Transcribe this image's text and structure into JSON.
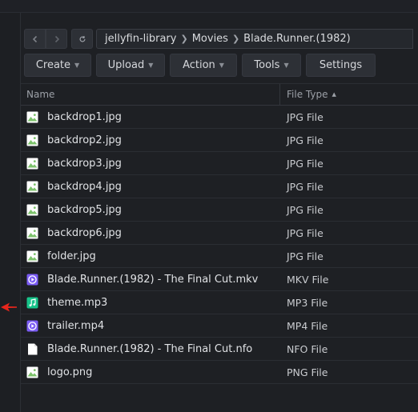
{
  "toolbar": {
    "back_icon": "chevron-left-icon",
    "forward_icon": "chevron-right-icon",
    "refresh_icon": "refresh-icon"
  },
  "breadcrumb": [
    "jellyfin-library",
    "Movies",
    "Blade.Runner.(1982)"
  ],
  "actions": [
    {
      "label": "Create",
      "dropdown": true
    },
    {
      "label": "Upload",
      "dropdown": true
    },
    {
      "label": "Action",
      "dropdown": true
    },
    {
      "label": "Tools",
      "dropdown": true
    },
    {
      "label": "Settings",
      "dropdown": false
    }
  ],
  "table": {
    "col_name": "Name",
    "col_type": "File Type",
    "rows": [
      {
        "name": "backdrop1.jpg",
        "type": "JPG File",
        "icon": "image-icon"
      },
      {
        "name": "backdrop2.jpg",
        "type": "JPG File",
        "icon": "image-icon"
      },
      {
        "name": "backdrop3.jpg",
        "type": "JPG File",
        "icon": "image-icon"
      },
      {
        "name": "backdrop4.jpg",
        "type": "JPG File",
        "icon": "image-icon"
      },
      {
        "name": "backdrop5.jpg",
        "type": "JPG File",
        "icon": "image-icon"
      },
      {
        "name": "backdrop6.jpg",
        "type": "JPG File",
        "icon": "image-icon"
      },
      {
        "name": "folder.jpg",
        "type": "JPG File",
        "icon": "image-icon"
      },
      {
        "name": "Blade.Runner.(1982) - The Final Cut.mkv",
        "type": "MKV File",
        "icon": "video-icon"
      },
      {
        "name": "theme.mp3",
        "type": "MP3 File",
        "icon": "audio-icon"
      },
      {
        "name": "trailer.mp4",
        "type": "MP4 File",
        "icon": "video-icon"
      },
      {
        "name": "Blade.Runner.(1982) - The Final Cut.nfo",
        "type": "NFO File",
        "icon": "document-icon"
      },
      {
        "name": "logo.png",
        "type": "PNG File",
        "icon": "image-icon"
      }
    ]
  },
  "colors": {
    "image_green": "#7cc26b",
    "video_purple": "#7b5cf5",
    "audio_teal": "#17c48a",
    "pointer_red": "#e8261c"
  }
}
